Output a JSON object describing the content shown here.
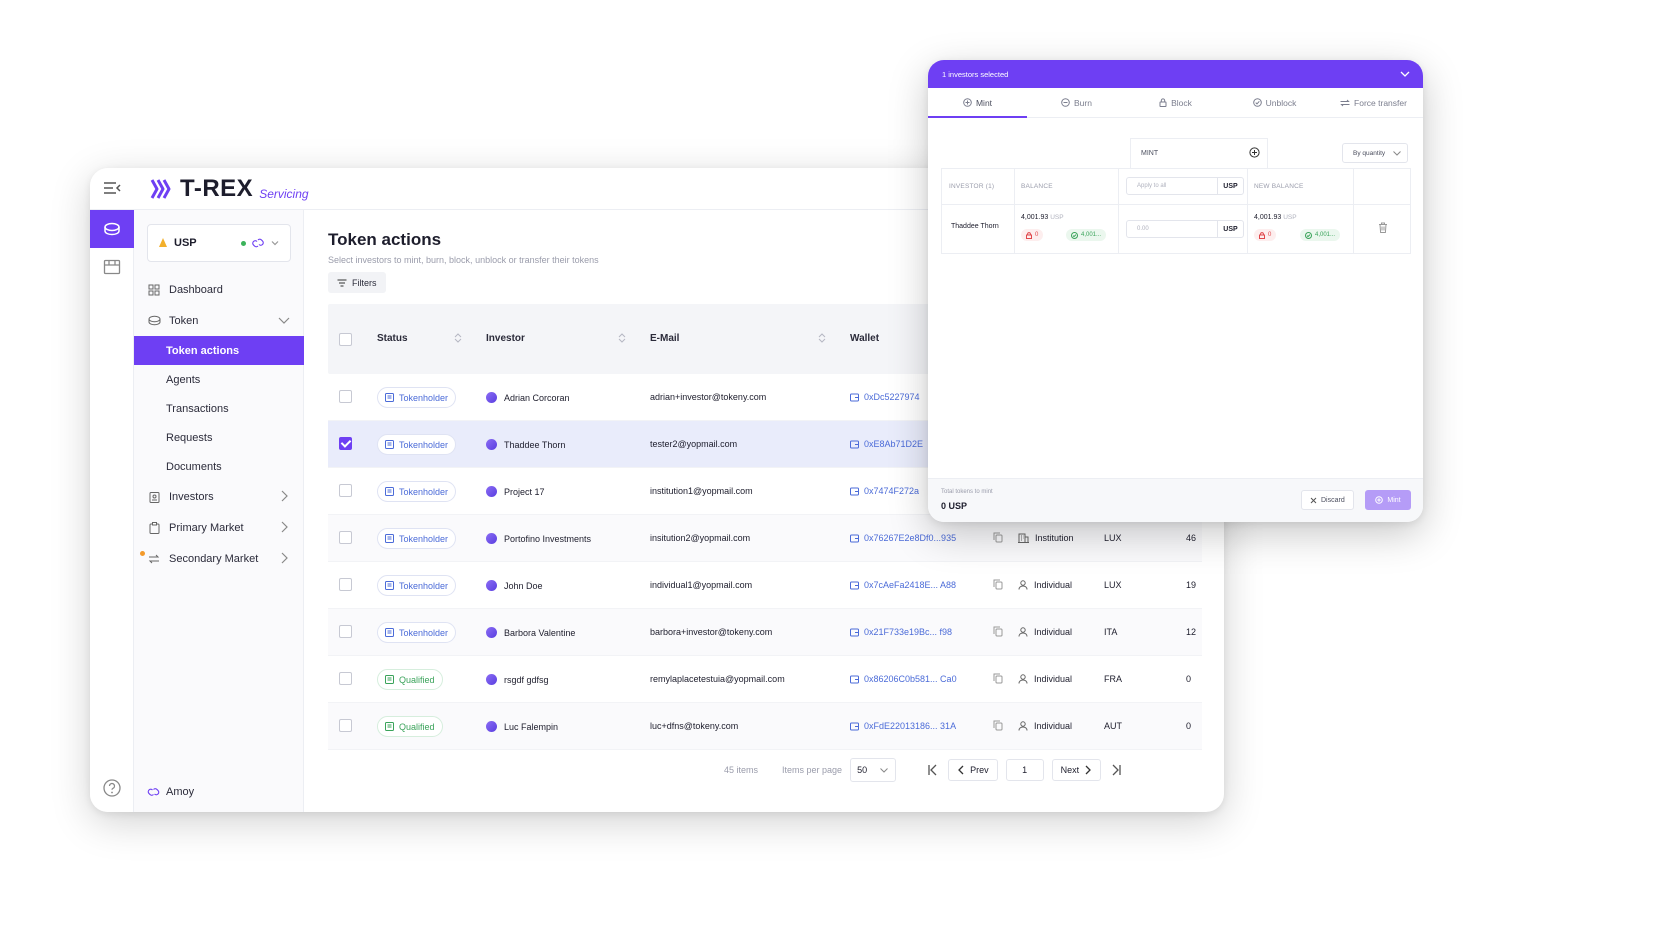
{
  "app": {
    "name": "T-REX",
    "subtitle": "Servicing"
  },
  "token_selector": {
    "name": "USP"
  },
  "sidebar": {
    "items": [
      {
        "label": "Dashboard",
        "icon": "dashboard-icon"
      },
      {
        "label": "Token",
        "icon": "coin-icon"
      },
      {
        "label": "Investors",
        "icon": "id-card-icon"
      },
      {
        "label": "Primary Market",
        "icon": "clipboard-icon"
      },
      {
        "label": "Secondary Market",
        "icon": "transfer-icon"
      }
    ],
    "token_sub": [
      "Token actions",
      "Agents",
      "Transactions",
      "Requests",
      "Documents"
    ],
    "network": "Amoy"
  },
  "page": {
    "title": "Token actions",
    "subtitle": "Select investors to mint, burn, block, unblock or transfer their tokens",
    "filters_label": "Filters"
  },
  "table": {
    "headers": {
      "status": "Status",
      "investor": "Investor",
      "email": "E-Mail",
      "wallet": "Wallet"
    },
    "rows": [
      {
        "status": "Tokenholder",
        "investor": "Adrian Corcoran",
        "email": "adrian+investor@tokeny.com",
        "wallet": "0xDc5227974",
        "type": "",
        "country": "",
        "amount": "",
        "selected": false
      },
      {
        "status": "Tokenholder",
        "investor": "Thaddee Thorn",
        "email": "tester2@yopmail.com",
        "wallet": "0xE8Ab71D2E",
        "type": "",
        "country": "",
        "amount": "",
        "selected": true
      },
      {
        "status": "Tokenholder",
        "investor": "Project 17",
        "email": "institution1@yopmail.com",
        "wallet": "0x7474F272a",
        "type": "",
        "country": "",
        "amount": "",
        "selected": false
      },
      {
        "status": "Tokenholder",
        "investor": "Portofino Investments",
        "email": "insitution2@yopmail.com",
        "wallet": "0x76267E2e8Df0...935",
        "type": "Institution",
        "country": "LUX",
        "amount": "46",
        "selected": false
      },
      {
        "status": "Tokenholder",
        "investor": "John Doe",
        "email": "individual1@yopmail.com",
        "wallet": "0x7cAeFa2418E... A88",
        "type": "Individual",
        "country": "LUX",
        "amount": "19",
        "selected": false
      },
      {
        "status": "Tokenholder",
        "investor": "Barbora Valentine",
        "email": "barbora+investor@tokeny.com",
        "wallet": "0x21F733e19Bc... f98",
        "type": "Individual",
        "country": "ITA",
        "amount": "12",
        "selected": false
      },
      {
        "status": "Qualified",
        "investor": "rsgdf gdfsg",
        "email": "remylaplacetestuia@yopmail.com",
        "wallet": "0x86206C0b581... Ca0",
        "type": "Individual",
        "country": "FRA",
        "amount": "0",
        "selected": false
      },
      {
        "status": "Qualified",
        "investor": "Luc Falempin",
        "email": "luc+dfns@tokeny.com",
        "wallet": "0xFdE22013186... 31A",
        "type": "Individual",
        "country": "AUT",
        "amount": "0",
        "selected": false
      }
    ]
  },
  "pagination": {
    "items": "45 items",
    "per_page_label": "Items per page",
    "per_page": "50",
    "prev": "Prev",
    "next": "Next",
    "page": "1"
  },
  "modal": {
    "header": "1 investors selected",
    "tabs": [
      "Mint",
      "Burn",
      "Block",
      "Unblock",
      "Force transfer"
    ],
    "mint_label": "MINT",
    "quantity_mode": "By quantity",
    "columns": {
      "investor": "INVESTOR (1)",
      "balance": "BALANCE",
      "new_balance": "NEW BALANCE"
    },
    "apply_all_placeholder": "Apply to all",
    "unit": "USP",
    "row": {
      "investor": "Thaddee Thorn",
      "balance": "4,001.93",
      "blocked": "0",
      "free": "4,001...",
      "amount_placeholder": "0.00",
      "new_balance": "4,001.93",
      "new_blocked": "0",
      "new_free": "4,001..."
    },
    "total_label": "Total tokens to mint",
    "total_value": "0 USP",
    "discard": "Discard",
    "mint": "Mint"
  },
  "colors": {
    "accent": "#6e3ff3",
    "link": "#4b6bd8",
    "qualified": "#3aa35a"
  }
}
